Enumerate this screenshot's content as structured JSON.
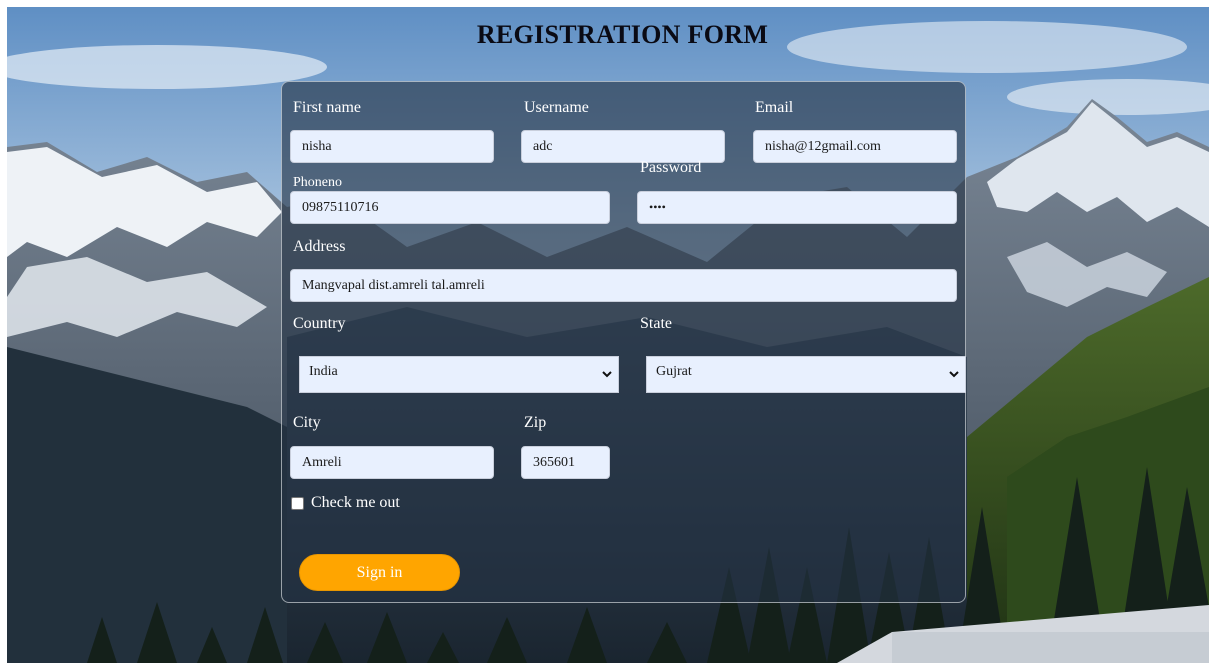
{
  "page": {
    "title": "REGISTRATION FORM"
  },
  "form": {
    "first_name": {
      "label": "First name",
      "value": "nisha"
    },
    "username": {
      "label": "Username",
      "value": "adc"
    },
    "email": {
      "label": "Email",
      "value": "nisha@12gmail.com"
    },
    "phone": {
      "label": "Phoneno",
      "value": "09875110716"
    },
    "password": {
      "label": "Password",
      "value": "••••"
    },
    "address": {
      "label": "Address",
      "value": "Mangvapal dist.amreli tal.amreli"
    },
    "country": {
      "label": "Country",
      "selected": "India"
    },
    "state": {
      "label": "State",
      "selected": "Gujrat"
    },
    "city": {
      "label": "City",
      "value": "Amreli"
    },
    "zip": {
      "label": "Zip",
      "value": "365601"
    },
    "check": {
      "label": "Check me out"
    },
    "submit_label": "Sign in"
  },
  "colors": {
    "accent": "#ffa500",
    "input_bg": "#e8f0fe",
    "panel": "#243244"
  }
}
